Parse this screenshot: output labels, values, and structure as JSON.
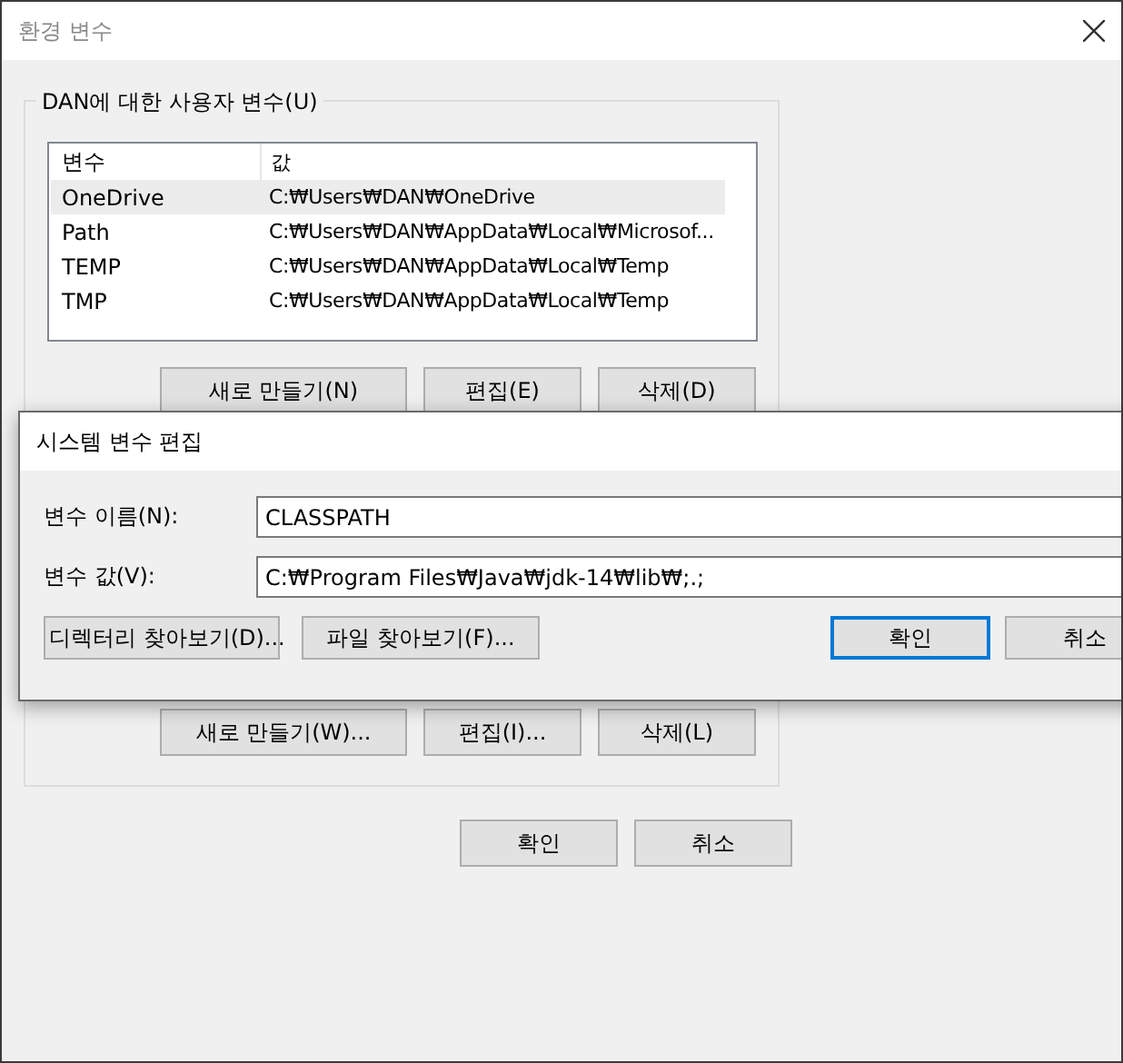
{
  "window": {
    "title": "환경 변수"
  },
  "user_variables": {
    "legend": "DAN에 대한 사용자 변수(U)",
    "columns": [
      "변수",
      "값"
    ],
    "rows": [
      {
        "name": "OneDrive",
        "value": "C:₩Users₩DAN₩OneDrive",
        "selected": true
      },
      {
        "name": "Path",
        "value": "C:₩Users₩DAN₩AppData₩Local₩Microsof...",
        "selected": false
      },
      {
        "name": "TEMP",
        "value": "C:₩Users₩DAN₩AppData₩Local₩Temp",
        "selected": false
      },
      {
        "name": "TMP",
        "value": "C:₩Users₩DAN₩AppData₩Local₩Temp",
        "selected": false
      }
    ],
    "buttons": [
      "새로 만들기(N)",
      "편집(E)",
      "삭제(D)"
    ]
  },
  "system_variables": {
    "buttons": [
      "새로 만들기(W)...",
      "편집(I)...",
      "삭제(L)"
    ]
  },
  "buttons": [
    "확인",
    "취소"
  ],
  "edit_dialog": {
    "title": "시스템 변수 편집",
    "fields": [
      {
        "label": "변수 이름(N):",
        "value": "CLASSPATH"
      },
      {
        "label": "변수 값(V):",
        "value": "C:₩Program Files₩Java₩jdk-14₩lib₩;.;"
      }
    ],
    "browse_buttons": [
      "디렉터리 찾아보기(D)...",
      "파일 찾아보기(F)..."
    ],
    "buttons": [
      {
        "label": "확인",
        "default": true
      },
      {
        "label": "취소",
        "default": false
      }
    ]
  }
}
